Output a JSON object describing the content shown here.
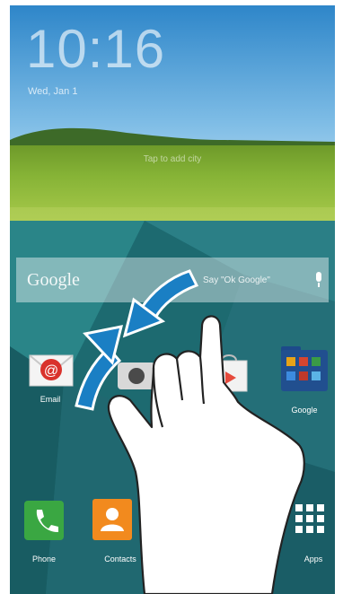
{
  "lockscreen": {
    "time": "10:16",
    "date": "Wed, Jan 1",
    "hint": "Tap to add city"
  },
  "search": {
    "logo": "Google",
    "hint": "Say \"Ok Google\"",
    "icon": "mic-icon"
  },
  "apps": [
    {
      "label": "Email",
      "icon": "email-icon"
    },
    {
      "label": "Google",
      "icon": "google-folder-icon"
    }
  ],
  "dock": [
    {
      "label": "Phone",
      "icon": "phone-icon"
    },
    {
      "label": "Contacts",
      "icon": "contacts-icon"
    },
    {
      "label": "Apps",
      "icon": "apps-grid-icon"
    }
  ],
  "gesture": {
    "type": "pinch",
    "description_icon": "pinch-arrows-icon"
  },
  "colors": {
    "background": "#1f6d72",
    "arrow": "#1a7fc4",
    "email": "#d9322c",
    "phone": "#3aa742",
    "contacts": "#f28a1e"
  }
}
